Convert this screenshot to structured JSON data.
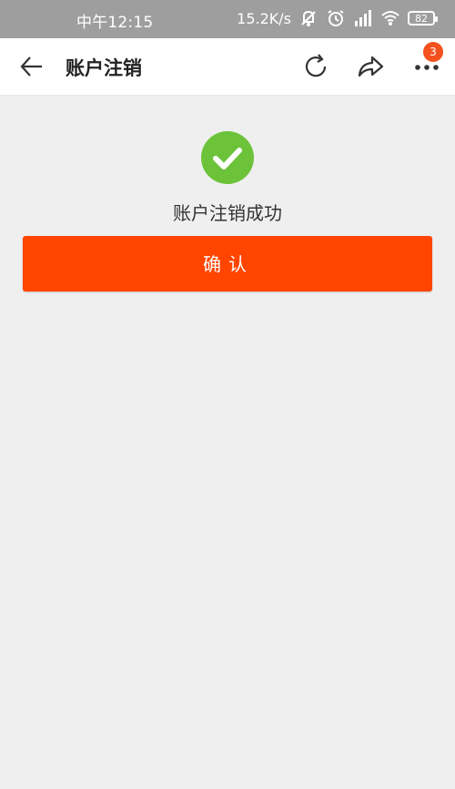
{
  "status_bar": {
    "time": "中午12:15",
    "network_speed": "15.2K/s",
    "battery": "82",
    "icons": [
      "vibrate-off-icon",
      "alarm-icon",
      "signal-icon",
      "wifi-icon",
      "battery-icon"
    ]
  },
  "nav": {
    "title": "账户注销",
    "badge_count": "3",
    "icons": [
      "back-arrow-icon",
      "refresh-icon",
      "share-icon",
      "more-icon"
    ]
  },
  "result": {
    "message": "账户注销成功",
    "icon": "success-check-icon",
    "success_color": "#6cc33a"
  },
  "actions": {
    "confirm_label": "确认",
    "confirm_color": "#ff4500"
  }
}
